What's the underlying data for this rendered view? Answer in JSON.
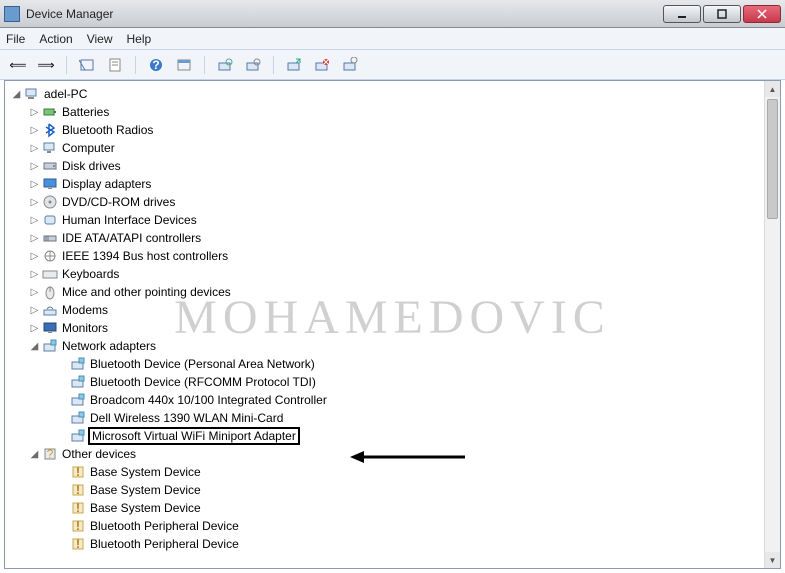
{
  "window": {
    "title": "Device Manager"
  },
  "menu": {
    "file": "File",
    "action": "Action",
    "view": "View",
    "help": "Help"
  },
  "tree": {
    "root": "adel-PC",
    "categories": [
      {
        "label": "Batteries",
        "icon": "battery-icon"
      },
      {
        "label": "Bluetooth Radios",
        "icon": "bluetooth-icon"
      },
      {
        "label": "Computer",
        "icon": "computer-icon"
      },
      {
        "label": "Disk drives",
        "icon": "disk-icon"
      },
      {
        "label": "Display adapters",
        "icon": "display-icon"
      },
      {
        "label": "DVD/CD-ROM drives",
        "icon": "cdrom-icon"
      },
      {
        "label": "Human Interface Devices",
        "icon": "hid-icon"
      },
      {
        "label": "IDE ATA/ATAPI controllers",
        "icon": "ide-icon"
      },
      {
        "label": "IEEE 1394 Bus host controllers",
        "icon": "ieee1394-icon"
      },
      {
        "label": "Keyboards",
        "icon": "keyboard-icon"
      },
      {
        "label": "Mice and other pointing devices",
        "icon": "mouse-icon"
      },
      {
        "label": "Modems",
        "icon": "modem-icon"
      },
      {
        "label": "Monitors",
        "icon": "monitor-icon"
      },
      {
        "label": "Network adapters",
        "icon": "network-icon",
        "expanded": true,
        "children": [
          {
            "label": "Bluetooth Device (Personal Area Network)",
            "icon": "netadapter-icon"
          },
          {
            "label": "Bluetooth Device (RFCOMM Protocol TDI)",
            "icon": "netadapter-icon"
          },
          {
            "label": "Broadcom 440x 10/100 Integrated Controller",
            "icon": "netadapter-icon"
          },
          {
            "label": "Dell Wireless 1390 WLAN Mini-Card",
            "icon": "netadapter-icon"
          },
          {
            "label": "Microsoft Virtual WiFi Miniport Adapter",
            "icon": "netadapter-icon",
            "highlighted": true
          }
        ]
      },
      {
        "label": "Other devices",
        "icon": "other-icon",
        "expanded": true,
        "children": [
          {
            "label": "Base System Device",
            "icon": "unknown-icon"
          },
          {
            "label": "Base System Device",
            "icon": "unknown-icon"
          },
          {
            "label": "Base System Device",
            "icon": "unknown-icon"
          },
          {
            "label": "Bluetooth Peripheral Device",
            "icon": "unknown-icon"
          },
          {
            "label": "Bluetooth Peripheral Device",
            "icon": "unknown-icon"
          }
        ]
      }
    ]
  },
  "watermark": "MOHAMEDOVIC"
}
